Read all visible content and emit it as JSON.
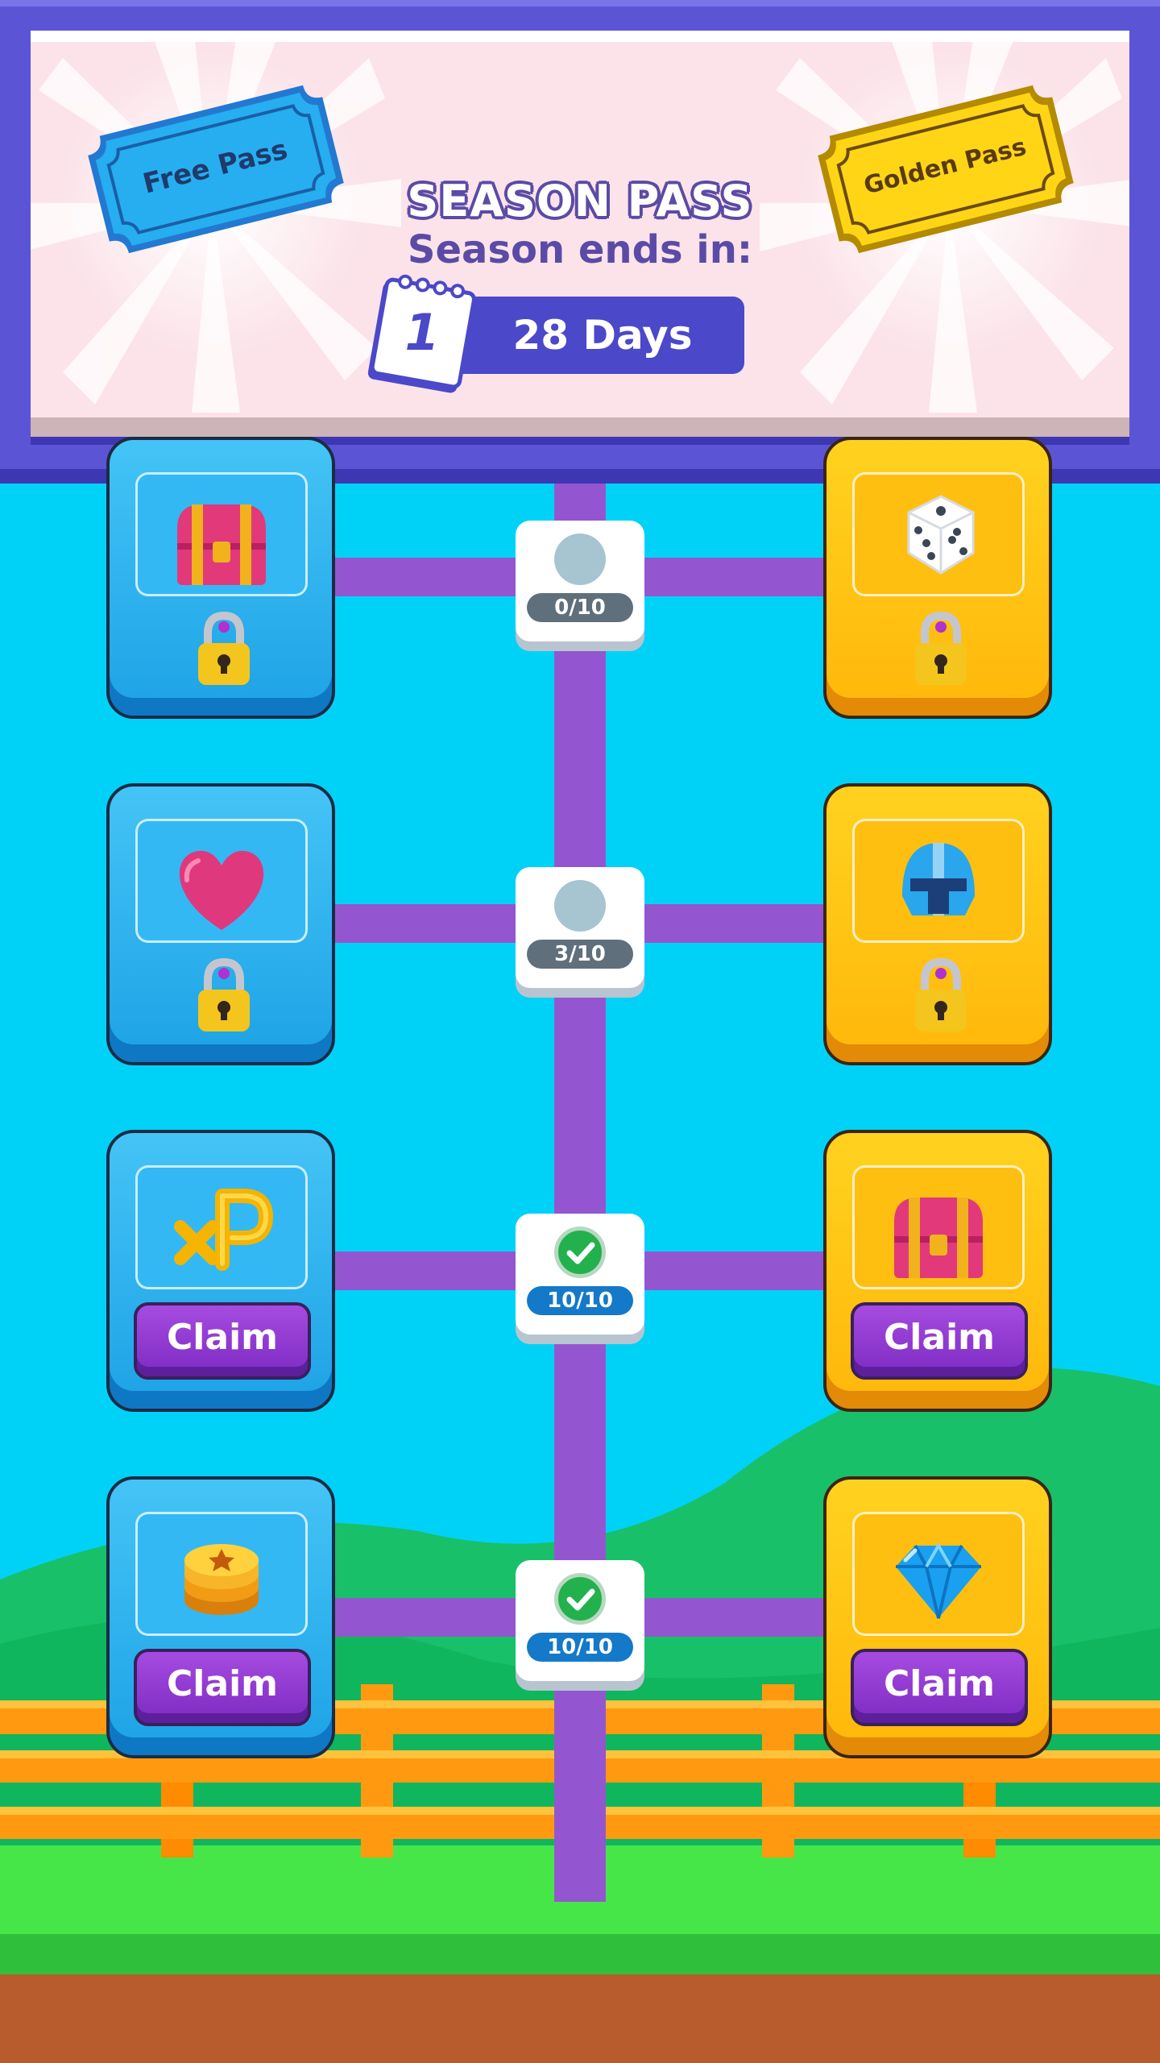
{
  "header": {
    "title": "SEASON PASS",
    "subtitle": "Season ends in:",
    "days_left": "28 Days",
    "calendar_day": "1",
    "free_pass_label": "Free Pass",
    "golden_pass_label": "Golden Pass"
  },
  "colors": {
    "sky": "#00d2f7",
    "track": "#9456d0",
    "free_card": "#1da2e6",
    "gold_card": "#ffb70a",
    "claim_button": "#8a35d0",
    "header_frame": "#5b55d6"
  },
  "tiers": [
    {
      "progress": "0/10",
      "completed": false,
      "free_reward": {
        "icon": "treasure-chest-icon",
        "state": "locked"
      },
      "gold_reward": {
        "icon": "dice-icon",
        "state": "locked"
      }
    },
    {
      "progress": "3/10",
      "completed": false,
      "free_reward": {
        "icon": "heart-icon",
        "state": "locked"
      },
      "gold_reward": {
        "icon": "helmet-icon",
        "state": "locked"
      }
    },
    {
      "progress": "10/10",
      "completed": true,
      "free_reward": {
        "icon": "xp-icon",
        "state": "claimable",
        "button_label": "Claim"
      },
      "gold_reward": {
        "icon": "treasure-chest-icon",
        "state": "claimable",
        "button_label": "Claim"
      }
    },
    {
      "progress": "10/10",
      "completed": true,
      "free_reward": {
        "icon": "coin-stack-icon",
        "state": "claimable",
        "button_label": "Claim"
      },
      "gold_reward": {
        "icon": "diamond-icon",
        "state": "claimable",
        "button_label": "Claim"
      }
    }
  ]
}
